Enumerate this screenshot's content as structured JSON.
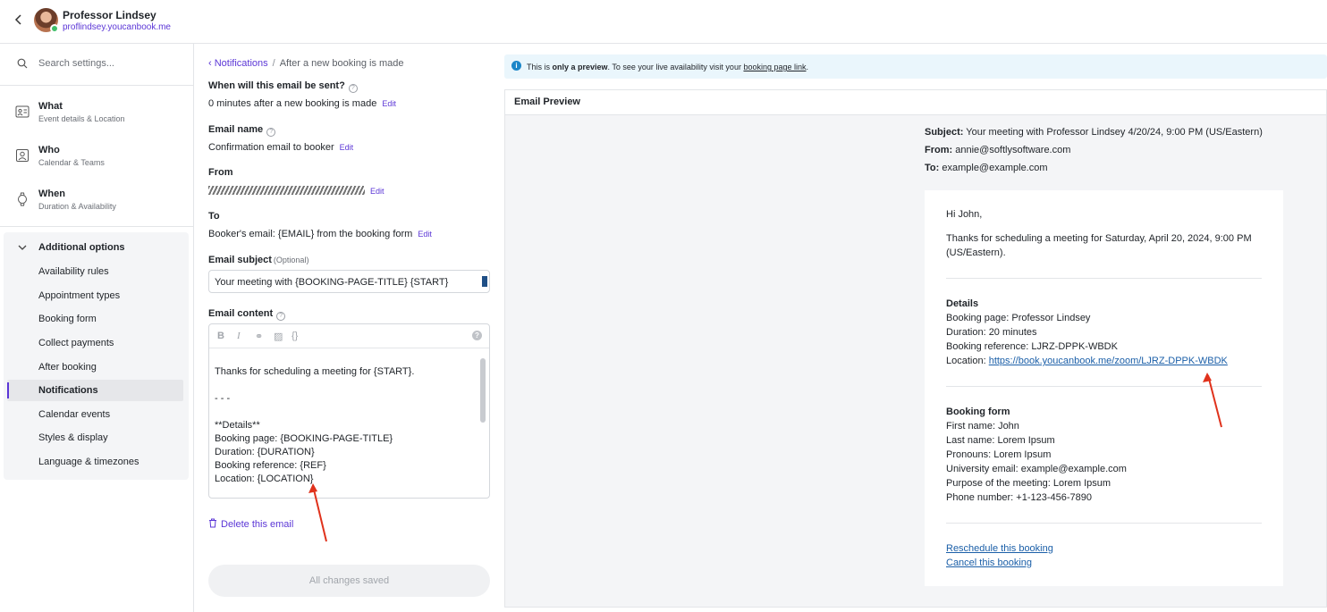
{
  "header": {
    "name": "Professor Lindsey",
    "url": "proflindsey.youcanbook.me"
  },
  "sidebar": {
    "search_placeholder": "Search settings...",
    "main": [
      {
        "title": "What",
        "sub": "Event details & Location",
        "icon": "id-card-icon"
      },
      {
        "title": "Who",
        "sub": "Calendar & Teams",
        "icon": "contact-icon"
      },
      {
        "title": "When",
        "sub": "Duration & Availability",
        "icon": "watch-icon"
      }
    ],
    "options_header": "Additional options",
    "options": [
      "Availability rules",
      "Appointment types",
      "Booking form",
      "Collect payments",
      "After booking",
      "Notifications",
      "Calendar events",
      "Styles & display",
      "Language & timezones"
    ],
    "active_option": "Notifications"
  },
  "editor": {
    "breadcrumb_link": "Notifications",
    "breadcrumb_current": "After a new booking is made",
    "when_label": "When will this email be sent?",
    "when_value": "0 minutes after a new booking is made",
    "edit": "Edit",
    "name_label": "Email name",
    "name_value": "Confirmation email to booker",
    "from_label": "From",
    "from_value": "Annie annie@softlysoftware.com",
    "to_label": "To",
    "to_value": "Booker's email: {EMAIL} from the booking form",
    "subject_label": "Email subject",
    "subject_optional": "(Optional)",
    "subject_value": "Your meeting with {BOOKING-PAGE-TITLE} {START}",
    "content_label": "Email content",
    "content_lines": [
      "Thanks for scheduling a meeting for {START}.",
      "",
      "- - -",
      "",
      "**Details**",
      "Booking page: {BOOKING-PAGE-TITLE}",
      "Duration: {DURATION}",
      "Booking reference: {REF}",
      "Location: {LOCATION}"
    ],
    "delete": "Delete this email",
    "save": "All changes saved"
  },
  "notice": {
    "prefix": "This is ",
    "bold": "only a preview",
    "middle": ". To see your live availability visit your ",
    "link": "booking page link",
    "suffix": "."
  },
  "preview": {
    "title": "Email Preview",
    "subject_label": "Subject:",
    "subject": "Your meeting with Professor Lindsey 4/20/24, 9:00 PM (US/Eastern)",
    "from_label": "From:",
    "from": "annie@softlysoftware.com",
    "to_label": "To:",
    "to": "example@example.com",
    "greeting": "Hi John,",
    "thanks_1": "Thanks for scheduling a meeting for Saturday, April 20, 2024, 9:00 PM",
    "thanks_2": "(US/Eastern).",
    "details_h": "Details",
    "booking_page": "Booking page: Professor Lindsey",
    "duration": "Duration: 20 minutes",
    "reference": "Booking reference: LJRZ-DPPK-WBDK",
    "location_label": "Location: ",
    "location_link": "https://book.youcanbook.me/zoom/LJRZ-DPPK-WBDK",
    "form_h": "Booking form",
    "form_lines": [
      "First name: John",
      "Last name: Lorem Ipsum",
      "Pronouns: Lorem Ipsum",
      "University email: example@example.com",
      "Purpose of the meeting: Lorem Ipsum",
      "Phone number: +1-123-456-7890"
    ],
    "reschedule": "Reschedule this booking",
    "cancel": "Cancel this booking"
  },
  "colors": {
    "accent": "#5b36d6",
    "annotation_arrow": "#e0321c",
    "link": "#1b5fa8"
  }
}
